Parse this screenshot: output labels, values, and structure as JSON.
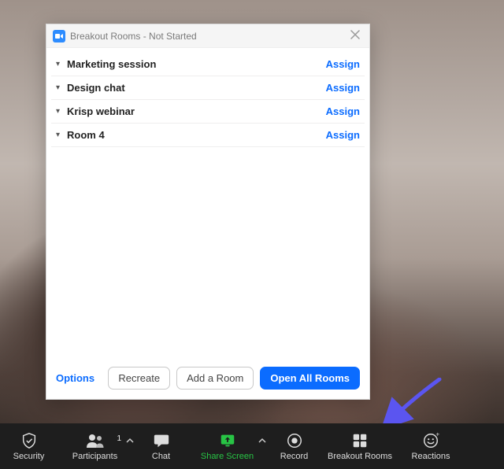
{
  "dialog": {
    "title": "Breakout Rooms - Not Started",
    "rooms": [
      {
        "name": "Marketing session",
        "assign": "Assign"
      },
      {
        "name": "Design chat",
        "assign": "Assign"
      },
      {
        "name": "Krisp webinar",
        "assign": "Assign"
      },
      {
        "name": "Room 4",
        "assign": "Assign"
      }
    ],
    "options_label": "Options",
    "recreate_label": "Recreate",
    "add_room_label": "Add a Room",
    "open_all_label": "Open All Rooms"
  },
  "toolbar": {
    "security": "Security",
    "participants": "Participants",
    "participants_count": "1",
    "chat": "Chat",
    "share": "Share Screen",
    "record": "Record",
    "breakout": "Breakout Rooms",
    "reactions": "Reactions"
  },
  "colors": {
    "accent": "#0b6cff",
    "share_green": "#28c445",
    "arrow": "#5b55f0"
  }
}
